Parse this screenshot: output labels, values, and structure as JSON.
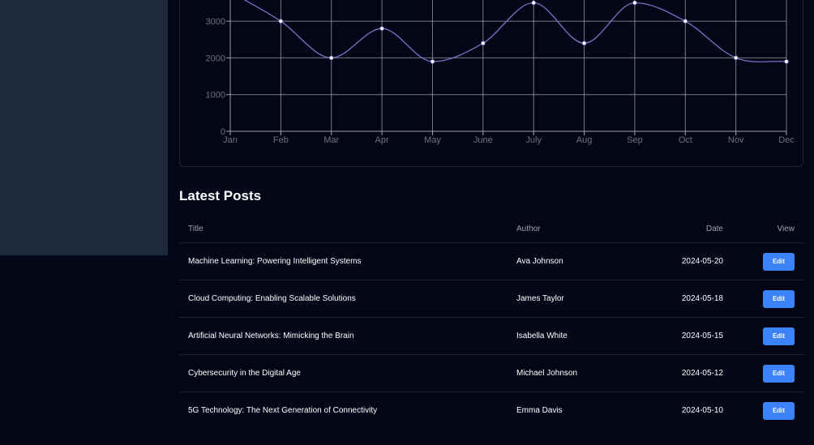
{
  "chart_data": {
    "type": "line",
    "categories": [
      "Jan",
      "Feb",
      "Mar",
      "Apr",
      "May",
      "June",
      "July",
      "Aug",
      "Sep",
      "Oct",
      "Nov",
      "Dec"
    ],
    "series": [
      {
        "values": [
          3800,
          3000,
          2000,
          2800,
          1900,
          2400,
          3500,
          2400,
          3500,
          3000,
          2000,
          1900
        ]
      }
    ],
    "yticks": [
      0,
      1000,
      2000,
      3000
    ],
    "ylim": [
      0,
      3500
    ],
    "grid": true,
    "line_color": "#7c7fd4",
    "grid_color": "#9ca3af"
  },
  "posts": {
    "heading": "Latest Posts",
    "columns": {
      "title": "Title",
      "author": "Author",
      "date": "Date",
      "view": "View"
    },
    "rows": [
      {
        "title": "Machine Learning: Powering Intelligent Systems",
        "author": "Ava Johnson",
        "date": "2024-05-20",
        "action": "Edit"
      },
      {
        "title": "Cloud Computing: Enabling Scalable Solutions",
        "author": "James Taylor",
        "date": "2024-05-18",
        "action": "Edit"
      },
      {
        "title": "Artificial Neural Networks: Mimicking the Brain",
        "author": "Isabella White",
        "date": "2024-05-15",
        "action": "Edit"
      },
      {
        "title": "Cybersecurity in the Digital Age",
        "author": "Michael Johnson",
        "date": "2024-05-12",
        "action": "Edit"
      },
      {
        "title": "5G Technology: The Next Generation of Connectivity",
        "author": "Emma Davis",
        "date": "2024-05-10",
        "action": "Edit"
      }
    ]
  },
  "colors": {
    "background": "#030616",
    "sidebar": "#1e293b",
    "accent": "#3b82f6"
  }
}
